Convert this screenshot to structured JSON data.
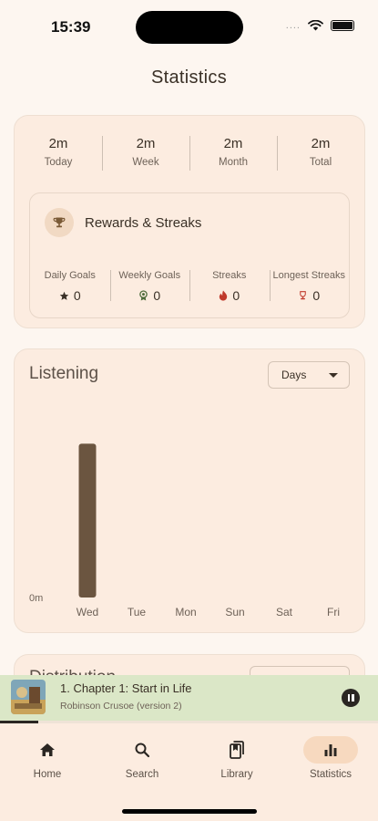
{
  "status_bar": {
    "time": "15:39",
    "signal": "....",
    "icons": [
      "wifi-icon",
      "battery-icon"
    ]
  },
  "page": {
    "title": "Statistics"
  },
  "totals": [
    {
      "value": "2m",
      "label": "Today"
    },
    {
      "value": "2m",
      "label": "Week"
    },
    {
      "value": "2m",
      "label": "Month"
    },
    {
      "value": "2m",
      "label": "Total"
    }
  ],
  "rewards": {
    "title": "Rewards & Streaks",
    "icon": "trophy-icon",
    "stats": [
      {
        "label": "Daily Goals",
        "value": "0",
        "icon": "star-icon"
      },
      {
        "label": "Weekly Goals",
        "value": "0",
        "icon": "medal-icon"
      },
      {
        "label": "Streaks",
        "value": "0",
        "icon": "flame-icon"
      },
      {
        "label": "Longest Streaks",
        "value": "0",
        "icon": "trophy-icon"
      }
    ]
  },
  "listening": {
    "title": "Listening",
    "range_select": "Days"
  },
  "chart_data": {
    "type": "bar",
    "categories": [
      "Wed",
      "Tue",
      "Mon",
      "Sun",
      "Sat",
      "Fri"
    ],
    "values": [
      2,
      0,
      0,
      0,
      0,
      0
    ],
    "y_tick_labels": [
      "0m"
    ],
    "ylim": [
      0,
      2.1
    ],
    "grid": false,
    "bar_color": "#6b5540"
  },
  "distribution": {
    "title": "Distribution"
  },
  "player": {
    "title": "1. Chapter 1: Start in Life",
    "subtitle": "Robinson Crusoe (version 2)",
    "progress": 0.1
  },
  "tabs": [
    {
      "label": "Home",
      "icon": "home-icon",
      "active": false
    },
    {
      "label": "Search",
      "icon": "search-icon",
      "active": false
    },
    {
      "label": "Library",
      "icon": "library-icon",
      "active": false
    },
    {
      "label": "Statistics",
      "icon": "bar-chart-icon",
      "active": true
    }
  ],
  "colors": {
    "background": "#fdf6f0",
    "card": "#fcece0",
    "accent": "#f7d9bf",
    "player_bg": "#dbe7c7",
    "streak_red": "#c0392b"
  }
}
